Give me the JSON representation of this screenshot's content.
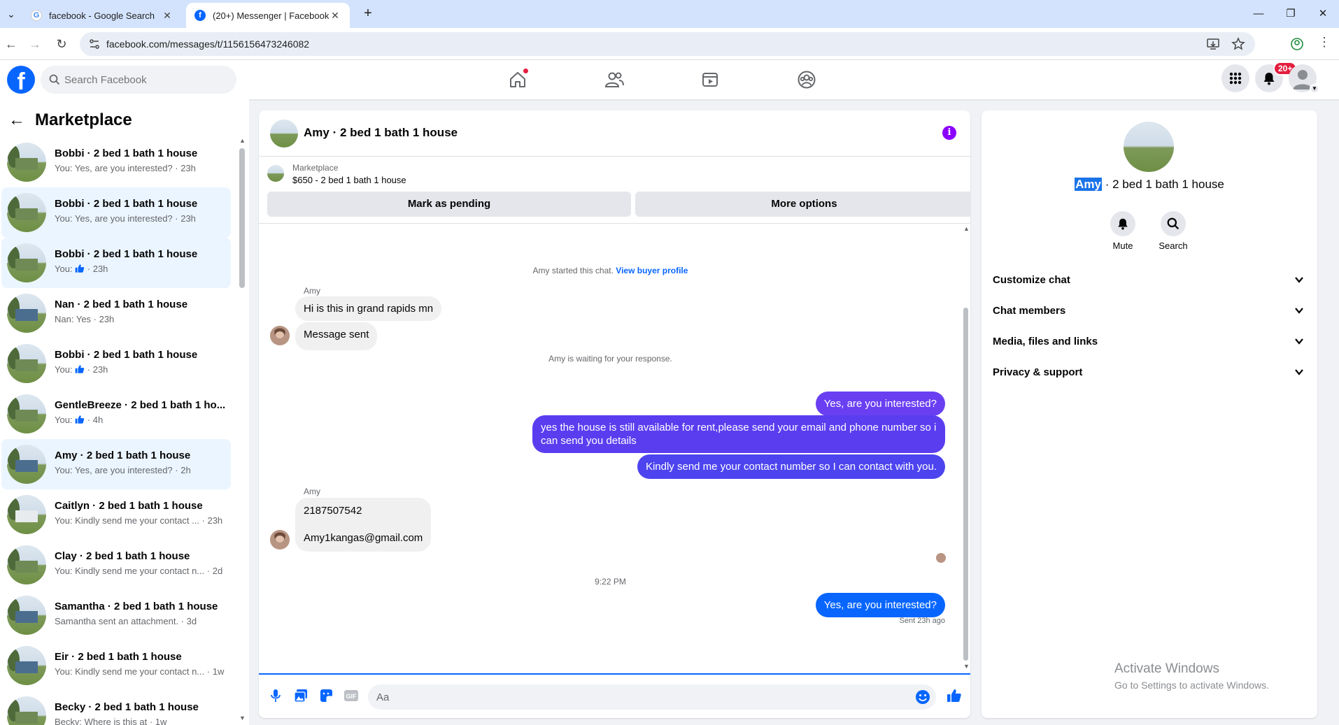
{
  "browser": {
    "tabs": [
      {
        "title": "facebook - Google Search",
        "active": false
      },
      {
        "title": "(20+) Messenger | Facebook",
        "active": true
      }
    ],
    "new_tab_label": "+",
    "url": "facebook.com/messages/t/1156156473246082"
  },
  "topnav": {
    "search_placeholder": "Search Facebook",
    "notifications_badge": "20+",
    "brand_color": "#0866ff"
  },
  "marketplace": {
    "title": "Marketplace",
    "conversations": [
      {
        "name": "Bobbi · 2 bed 1 bath 1 house",
        "prefix": "You: Yes, are you interested?",
        "time": " · 23h",
        "thumb": false,
        "selected": false,
        "house": "green"
      },
      {
        "name": "Bobbi · 2 bed 1 bath 1 house",
        "prefix": "You: Yes, are you interested?",
        "time": " · 23h",
        "thumb": false,
        "selected": true,
        "house": "green"
      },
      {
        "name": "Bobbi · 2 bed 1 bath 1 house",
        "prefix": "You: ",
        "time": " · 23h",
        "thumb": true,
        "selected": true,
        "house": "green"
      },
      {
        "name": "Nan · 2 bed 1 bath 1 house",
        "prefix": "Nan: Yes",
        "time": " · 23h",
        "thumb": false,
        "selected": false,
        "house": "blue"
      },
      {
        "name": "Bobbi · 2 bed 1 bath 1 house",
        "prefix": "You: ",
        "time": " · 23h",
        "thumb": true,
        "selected": false,
        "house": "green"
      },
      {
        "name": "GentleBreeze · 2 bed 1 bath 1 ho...",
        "prefix": "You: ",
        "time": " · 4h",
        "thumb": true,
        "selected": false,
        "house": "green"
      },
      {
        "name": "Amy · 2 bed 1 bath 1 house",
        "prefix": "You: Yes, are you interested?",
        "time": " · 2h",
        "thumb": false,
        "selected": true,
        "house": "blue"
      },
      {
        "name": "Caitlyn · 2 bed 1 bath 1 house",
        "prefix": "You: Kindly send me your contact ...",
        "time": " · 23h",
        "thumb": false,
        "selected": false,
        "house": "white"
      },
      {
        "name": "Clay · 2 bed 1 bath 1 house",
        "prefix": "You: Kindly send me your contact n...",
        "time": " · 2d",
        "thumb": false,
        "selected": false,
        "house": "green"
      },
      {
        "name": "Samantha · 2 bed 1 bath 1 house",
        "prefix": "Samantha sent an attachment.",
        "time": " · 3d",
        "thumb": false,
        "selected": false,
        "house": "blue"
      },
      {
        "name": "Eir · 2 bed 1 bath 1 house",
        "prefix": "You: Kindly send me your contact n...",
        "time": " · 1w",
        "thumb": false,
        "selected": false,
        "house": "blue"
      },
      {
        "name": "Becky · 2 bed 1 bath 1 house",
        "prefix": "Becky: Where is this at",
        "time": " · 1w",
        "thumb": false,
        "selected": false,
        "house": "green"
      }
    ]
  },
  "chat": {
    "title": "Amy · 2 bed 1 bath 1 house",
    "listing": {
      "category": "Marketplace",
      "price_title": "$650 - 2 bed 1 bath 1 house",
      "mark_pending_label": "Mark as pending",
      "more_options_label": "More options"
    },
    "system_started": "Amy started this chat.",
    "view_profile_label": "View buyer profile",
    "sender_name": "Amy",
    "incoming_1": [
      "Hi is this in grand rapids mn",
      "Message sent"
    ],
    "waiting_text": "Amy is waiting for your response.",
    "outgoing": [
      {
        "text": "Yes, are you interested?",
        "color": "#6a3ff2"
      },
      {
        "text": "yes the house is still available for rent,please send your email and phone number so i can send you details",
        "color": "#5b3df0"
      },
      {
        "text": "Kindly send me your contact number so I can contact with you.",
        "color": "#4d44ef"
      }
    ],
    "incoming_2": [
      "2187507542",
      "Amy1kangas@gmail.com"
    ],
    "timestamp": "9:22 PM",
    "last_outgoing": {
      "text": "Yes, are you interested?",
      "color": "#0866ff"
    },
    "sent_status": "Sent 23h ago",
    "composer_placeholder": "Aa"
  },
  "details": {
    "name_highlight": "Amy",
    "name_rest": " · 2 bed 1 bath 1 house",
    "actions": [
      {
        "label": "Mute",
        "icon": "bell-icon"
      },
      {
        "label": "Search",
        "icon": "search-icon"
      }
    ],
    "sections": [
      "Customize chat",
      "Chat members",
      "Media, files and links",
      "Privacy & support"
    ]
  },
  "watermark": {
    "line1": "Activate Windows",
    "line2": "Go to Settings to activate Windows."
  }
}
